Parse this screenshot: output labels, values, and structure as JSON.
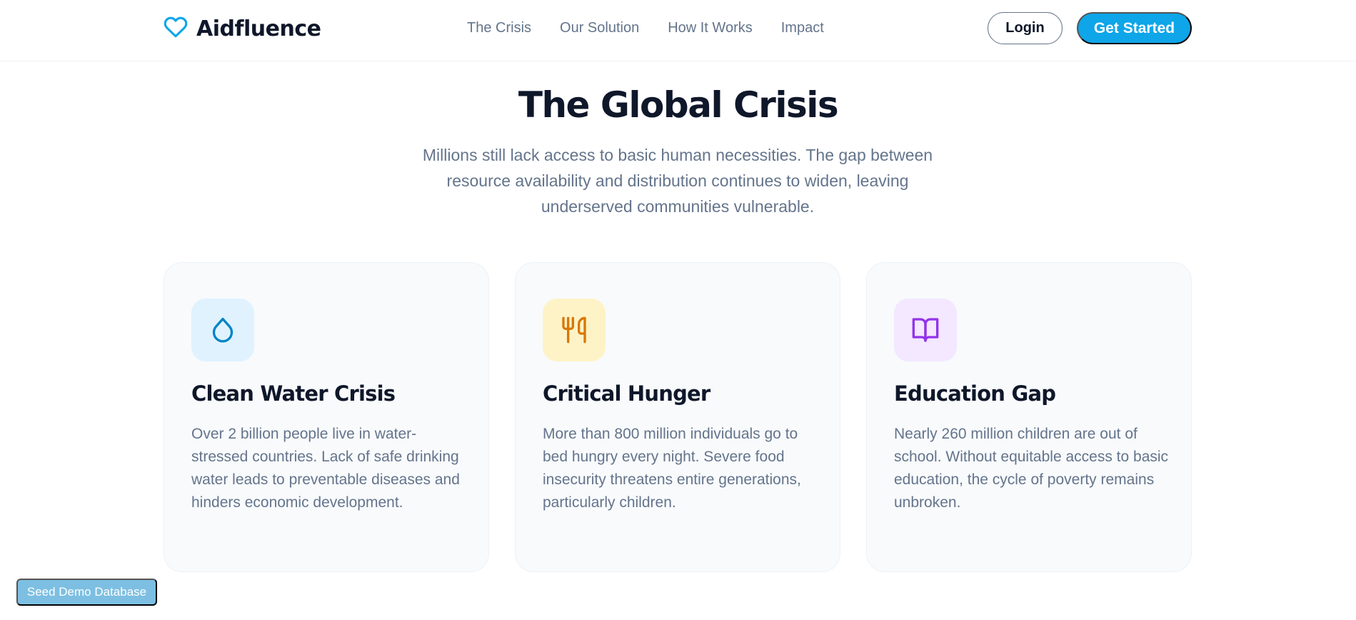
{
  "header": {
    "brand": "Aidfluence",
    "nav": [
      {
        "label": "The Crisis"
      },
      {
        "label": "Our Solution"
      },
      {
        "label": "How It Works"
      },
      {
        "label": "Impact"
      }
    ],
    "login_label": "Login",
    "get_started_label": "Get Started",
    "accent_color": "#0ea5e9"
  },
  "hero": {
    "title": "The Global Crisis",
    "subtitle": "Millions still lack access to basic human necessities. The gap between resource availability and distribution continues to widen, leaving underserved communities vulnerable."
  },
  "cards": [
    {
      "icon": "water-drop-icon",
      "icon_color": "#0284c7",
      "icon_bg": "#e0f2fe",
      "title": "Clean Water Crisis",
      "text": "Over 2 billion people live in water-stressed countries. Lack of safe drinking water leads to preventable diseases and hinders economic development."
    },
    {
      "icon": "utensils-icon",
      "icon_color": "#d97706",
      "icon_bg": "#fef3c7",
      "title": "Critical Hunger",
      "text": "More than 800 million individuals go to bed hungry every night. Severe food insecurity threatens entire generations, particularly children."
    },
    {
      "icon": "open-book-icon",
      "icon_color": "#9333ea",
      "icon_bg": "#f3e8ff",
      "title": "Education Gap",
      "text": "Nearly 260 million children are out of school. Without equitable access to basic education, the cycle of poverty remains unbroken."
    }
  ],
  "seed_button_label": "Seed Demo Database"
}
